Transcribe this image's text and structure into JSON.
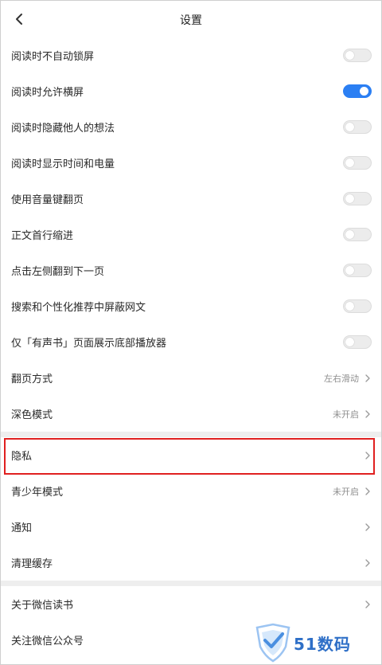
{
  "header": {
    "title": "设置"
  },
  "toggles": [
    {
      "label": "阅读时不自动锁屏",
      "on": false
    },
    {
      "label": "阅读时允许横屏",
      "on": true
    },
    {
      "label": "阅读时隐藏他人的想法",
      "on": false
    },
    {
      "label": "阅读时显示时间和电量",
      "on": false
    },
    {
      "label": "使用音量键翻页",
      "on": false
    },
    {
      "label": "正文首行缩进",
      "on": false
    },
    {
      "label": "点击左侧翻到下一页",
      "on": false
    },
    {
      "label": "搜索和个性化推荐中屏蔽网文",
      "on": false
    },
    {
      "label": "仅「有声书」页面展示底部播放器",
      "on": false
    }
  ],
  "section1": [
    {
      "label": "翻页方式",
      "value": "左右滑动"
    },
    {
      "label": "深色模式",
      "value": "未开启"
    }
  ],
  "section2": [
    {
      "label": "隐私",
      "value": ""
    },
    {
      "label": "青少年模式",
      "value": "未开启"
    },
    {
      "label": "通知",
      "value": ""
    },
    {
      "label": "清理缓存",
      "value": ""
    }
  ],
  "section3": [
    {
      "label": "关于微信读书",
      "value": ""
    },
    {
      "label": "关注微信公众号",
      "value": ""
    }
  ],
  "watermark": {
    "text": "51数码"
  },
  "colors": {
    "toggle_on": "#2b7ff3",
    "highlight": "#e02020",
    "separator": "#eeeeee"
  }
}
